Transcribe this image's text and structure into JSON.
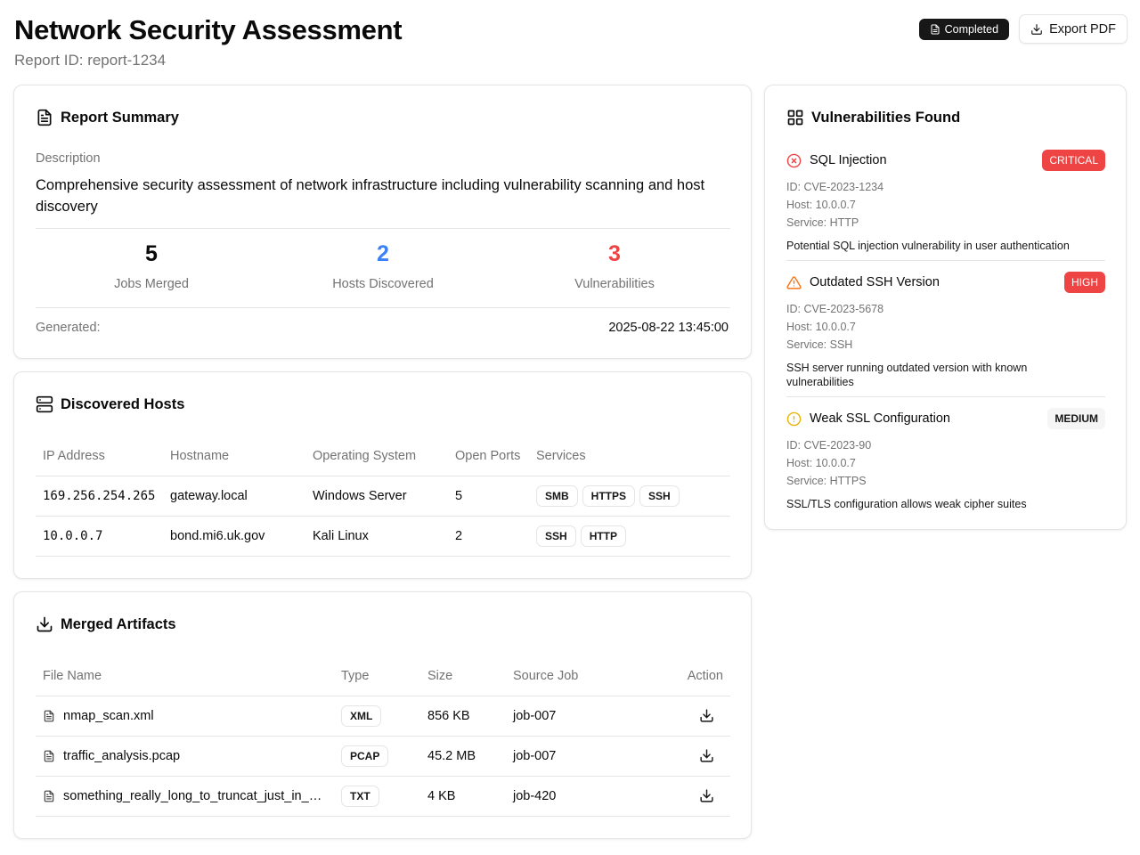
{
  "header": {
    "title": "Network Security Assessment",
    "report_id": "Report ID: report-1234",
    "status": "Completed",
    "export_label": "Export PDF"
  },
  "summary": {
    "title": "Report Summary",
    "description_label": "Description",
    "description": "Comprehensive security assessment of network infrastructure including vulnerability scanning and host discovery",
    "stats": [
      {
        "value": "5",
        "label": "Jobs Merged",
        "color": "#0a0a0a"
      },
      {
        "value": "2",
        "label": "Hosts Discovered",
        "color": "#3b82f6"
      },
      {
        "value": "3",
        "label": "Vulnerabilities",
        "color": "#ef4444"
      }
    ],
    "generated_label": "Generated:",
    "generated_value": "2025-08-22 13:45:00"
  },
  "hosts": {
    "title": "Discovered Hosts",
    "columns": [
      "IP Address",
      "Hostname",
      "Operating System",
      "Open Ports",
      "Services"
    ],
    "rows": [
      {
        "ip": "169.256.254.265",
        "hostname": "gateway.local",
        "os": "Windows Server",
        "ports": "5",
        "services": [
          "SMB",
          "HTTPS",
          "SSH"
        ]
      },
      {
        "ip": "10.0.0.7",
        "hostname": "bond.mi6.uk.gov",
        "os": "Kali Linux",
        "ports": "2",
        "services": [
          "SSH",
          "HTTP"
        ]
      }
    ]
  },
  "artifacts": {
    "title": "Merged Artifacts",
    "columns": [
      "File Name",
      "Type",
      "Size",
      "Source Job",
      "Action"
    ],
    "rows": [
      {
        "name": "nmap_scan.xml",
        "type": "XML",
        "size": "856 KB",
        "job": "job-007"
      },
      {
        "name": "traffic_analysis.pcap",
        "type": "PCAP",
        "size": "45.2 MB",
        "job": "job-007"
      },
      {
        "name": "something_really_long_to_truncat_just_in_case_it_goes_on",
        "type": "TXT",
        "size": "4 KB",
        "job": "job-420"
      }
    ]
  },
  "vulns": {
    "title": "Vulnerabilities Found",
    "items": [
      {
        "name": "SQL Injection",
        "severity": "CRITICAL",
        "icon": "x-circle-icon",
        "icon_color": "#ef4444",
        "id": "ID: CVE-2023-1234",
        "host": "Host: 10.0.0.7",
        "service": "Service: HTTP",
        "description": "Potential SQL injection vulnerability in user authentication"
      },
      {
        "name": "Outdated SSH Version",
        "severity": "HIGH",
        "icon": "warning-triangle-icon",
        "icon_color": "#f97316",
        "id": "ID: CVE-2023-5678",
        "host": "Host: 10.0.0.7",
        "service": "Service: SSH",
        "description": "SSH server running outdated version with known vulnerabilities"
      },
      {
        "name": "Weak SSL Configuration",
        "severity": "MEDIUM",
        "icon": "alert-circle-icon",
        "icon_color": "#eab308",
        "id": "ID: CVE-2023-90",
        "host": "Host: 10.0.0.7",
        "service": "Service: HTTPS",
        "description": "SSL/TLS configuration allows weak cipher suites"
      }
    ]
  }
}
